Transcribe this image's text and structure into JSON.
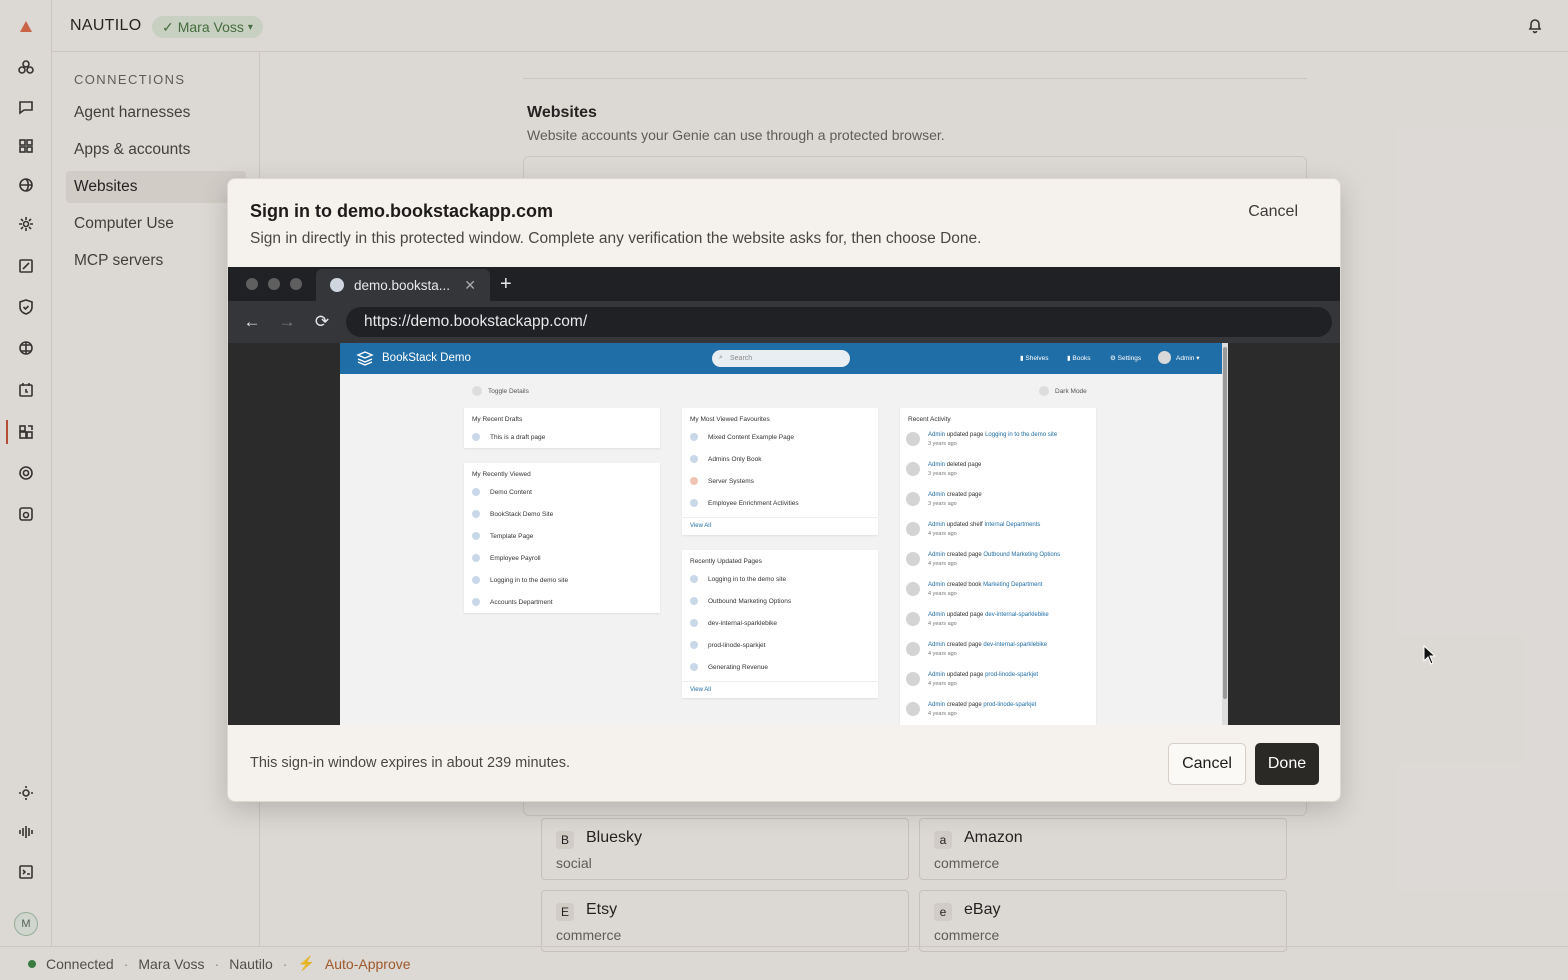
{
  "app": {
    "brand": "NAUTILO",
    "user": "Mara Voss",
    "avatar_initial": "M"
  },
  "sidebar": {
    "section": "CONNECTIONS",
    "items": [
      {
        "label": "Agent harnesses"
      },
      {
        "label": "Apps & accounts"
      },
      {
        "label": "Websites"
      },
      {
        "label": "Computer Use"
      },
      {
        "label": "MCP servers"
      }
    ]
  },
  "content": {
    "title": "Websites",
    "subtitle": "Website accounts your Genie can use through a protected browser.",
    "cards": [
      {
        "badge": "B",
        "name": "Bluesky",
        "type": "social"
      },
      {
        "badge": "a",
        "name": "Amazon",
        "type": "commerce"
      },
      {
        "badge": "E",
        "name": "Etsy",
        "type": "commerce"
      },
      {
        "badge": "e",
        "name": "eBay",
        "type": "commerce"
      }
    ]
  },
  "status": {
    "connected": "Connected",
    "user": "Mara Voss",
    "app": "Nautilo",
    "mode": "Auto-Approve"
  },
  "modal": {
    "title": "Sign in to demo.bookstackapp.com",
    "description": "Sign in directly in this protected window. Complete any verification the website asks for, then choose Done.",
    "cancel_top": "Cancel",
    "expiry": "This sign-in window expires in about 239 minutes.",
    "cancel": "Cancel",
    "done": "Done"
  },
  "browser": {
    "tab_title": "demo.booksta...",
    "url": "https://demo.bookstackapp.com/"
  },
  "bookstack": {
    "brand": "BookStack Demo",
    "search_placeholder": "Search",
    "nav": {
      "shelves": "Shelves",
      "books": "Books",
      "settings": "Settings",
      "user": "Admin"
    },
    "toggle_details": "Toggle Details",
    "dark_mode": "Dark Mode",
    "recent_drafts": {
      "title": "My Recent Drafts",
      "items": [
        "This is a draft page"
      ]
    },
    "recently_viewed": {
      "title": "My Recently Viewed",
      "items": [
        "Demo Content",
        "BookStack Demo Site",
        "Template Page",
        "Employee Payroll",
        "Logging in to the demo site",
        "Accounts Department"
      ]
    },
    "favourites": {
      "title": "My Most Viewed Favourites",
      "items": [
        "Mixed Content Example Page",
        "Admins Only Book",
        "Server Systems",
        "Employee Enrichment Activities"
      ],
      "view_all": "View All"
    },
    "updated": {
      "title": "Recently Updated Pages",
      "items": [
        "Logging in to the demo site",
        "Outbound Marketing Options",
        "dev-internal-sparklebike",
        "prod-linode-sparkjet",
        "Generating Revenue"
      ],
      "view_all": "View All"
    },
    "activity": {
      "title": "Recent Activity",
      "items": [
        {
          "user": "Admin",
          "action": "updated page",
          "target": "Logging in to the demo site",
          "time": "3 years ago"
        },
        {
          "user": "Admin",
          "action": "deleted page",
          "target": "",
          "time": "3 years ago"
        },
        {
          "user": "Admin",
          "action": "created page",
          "target": "",
          "time": "3 years ago"
        },
        {
          "user": "Admin",
          "action": "updated shelf",
          "target": "Internal Departments",
          "time": "4 years ago"
        },
        {
          "user": "Admin",
          "action": "created page",
          "target": "Outbound Marketing Options",
          "time": "4 years ago"
        },
        {
          "user": "Admin",
          "action": "created book",
          "target": "Marketing Department",
          "time": "4 years ago"
        },
        {
          "user": "Admin",
          "action": "updated page",
          "target": "dev-internal-sparklebike",
          "time": "4 years ago"
        },
        {
          "user": "Admin",
          "action": "created page",
          "target": "dev-internal-sparklebike",
          "time": "4 years ago"
        },
        {
          "user": "Admin",
          "action": "updated page",
          "target": "prod-linode-sparkjet",
          "time": "4 years ago"
        },
        {
          "user": "Admin",
          "action": "created page",
          "target": "prod-linode-sparkjet",
          "time": "4 years ago"
        }
      ]
    }
  }
}
